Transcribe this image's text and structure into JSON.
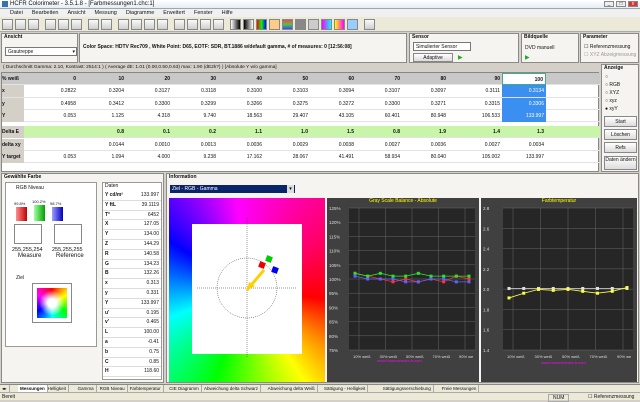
{
  "app": {
    "title": "HCFR Colorimeter - 3.5.1.8 - [Farbmessungen1.chc:1]"
  },
  "menu": [
    "Datei",
    "Bearbeiten",
    "Ansicht",
    "Messung",
    "Diagramme",
    "Erweitert",
    "Fenster",
    "Hilfe"
  ],
  "ansicht": {
    "title": "Ansicht",
    "value": "Grautreppe"
  },
  "colorspace": {
    "text": "Color Space: HDTV Rec709 , White Point: D65, EOTF: SDR, BT.1886 w/default gamma, # of measures: 0 [12:56:08]"
  },
  "sensor": {
    "title": "Sensor",
    "value": "Simulierter Sensor",
    "button": "Adaptive"
  },
  "source": {
    "title": "Bildquelle",
    "value": "DVD manuell"
  },
  "params": {
    "title": "Parameter",
    "check1": "Referenzmessung",
    "check2": "XYZ Abzeigmessung"
  },
  "summary": "( Durchschnitt Gamma: 2.10, Kontrast: 2514:1 ) ( Average dE: 1.01 (0.00,0.50,0.63) max: 1.90 (dE2k?) )  [Absolute Y w/o gamma]",
  "grid": {
    "header": [
      "% weiß",
      "0",
      "10",
      "20",
      "30",
      "40",
      "50",
      "60",
      "70",
      "80",
      "90",
      "100"
    ],
    "rows": [
      {
        "label": "x",
        "values": [
          "0.2822",
          "0.3204",
          "0.3127",
          "0.3118",
          "0.3100",
          "0.3103",
          "0.3094",
          "0.3107",
          "0.3097",
          "0.3111",
          "0.3134"
        ]
      },
      {
        "label": "y",
        "values": [
          "0.4958",
          "0.3412",
          "0.3300",
          "0.3299",
          "0.3266",
          "0.3275",
          "0.3272",
          "0.3300",
          "0.3271",
          "0.3315",
          "0.3306"
        ]
      },
      {
        "label": "Y",
        "values": [
          "0.053",
          "1.125",
          "4.318",
          "9.740",
          "18.563",
          "29.407",
          "43.105",
          "60.401",
          "80.948",
          "106.533",
          "133.997"
        ]
      },
      {
        "label": "Delta E",
        "values": [
          "",
          "0.8",
          "0.1",
          "0.2",
          "1.1",
          "1.0",
          "1.5",
          "0.8",
          "1.9",
          "1.4",
          "1.3"
        ]
      },
      {
        "label": "delta xy",
        "values": [
          "",
          "0.0144",
          "0.0010",
          "0.0013",
          "0.0036",
          "0.0029",
          "0.0038",
          "0.0027",
          "0.0036",
          "0.0027",
          "0.0034"
        ]
      },
      {
        "label": "Y target",
        "values": [
          "0.053",
          "1.094",
          "4.000",
          "9.238",
          "17.162",
          "28.067",
          "41.491",
          "58.934",
          "80.040",
          "105.002",
          "133.997"
        ]
      }
    ]
  },
  "sidebar": {
    "title": "Anzeige",
    "options": [
      "",
      "RGB",
      "XYZ",
      "xyz",
      "xyY"
    ],
    "buttons": [
      "Start",
      "Löschen",
      "Refs",
      "Daten ändern"
    ]
  },
  "selected": {
    "title": "Gewählte Farbe",
    "rgb_title": "RGB Niveau",
    "bars": [
      "99.8%",
      "100.2%",
      "98.7%"
    ],
    "bar_colors": [
      "#e02020",
      "#20c020",
      "#2040e0"
    ],
    "measure_value": "255,255,254",
    "measure_label": "Measure",
    "reference_value": "255,255,255",
    "reference_label": "Reference",
    "ziel": "Ziel"
  },
  "data": {
    "title": "Daten",
    "rows": [
      [
        "Y cd/m²",
        "133.997"
      ],
      [
        "Y ftL",
        "39.1119"
      ],
      [
        "T°",
        "6452"
      ],
      [
        "X",
        "127.05"
      ],
      [
        "Y",
        "134.00"
      ],
      [
        "Z",
        "144.29"
      ],
      [
        "R",
        "140.58"
      ],
      [
        "G",
        "134.23"
      ],
      [
        "B",
        "132.26"
      ],
      [
        "x",
        "0.313"
      ],
      [
        "y",
        "0.331"
      ],
      [
        "Y",
        "133.997"
      ],
      [
        "u'",
        "0.195"
      ],
      [
        "v'",
        "0.465"
      ],
      [
        "L",
        "100.00"
      ],
      [
        "a",
        "-0.41"
      ],
      [
        "b",
        "0.75"
      ],
      [
        "C",
        "0.85"
      ],
      [
        "H",
        "118.60"
      ]
    ]
  },
  "info": {
    "title": "Information",
    "dropdown": "Ziel - RGB - Gamma"
  },
  "chart1": {
    "title": "Gray Scale Balance - Absolute",
    "yticks": [
      "125%",
      "120%",
      "115%",
      "110%",
      "105%",
      "100%",
      "95%",
      "90%",
      "85%",
      "80%",
      "75%"
    ],
    "xticks": [
      "10% weiß",
      "30% weiß",
      "50% weiß",
      "70% weiß",
      "90% we"
    ],
    "series": [
      {
        "name": "R",
        "color": "#ff3030",
        "values": [
          102,
          101,
          100,
          99,
          100,
          99,
          100,
          99,
          101,
          100
        ]
      },
      {
        "name": "G",
        "color": "#30e030",
        "values": [
          102,
          101,
          102,
          101,
          101,
          102,
          101,
          101,
          101,
          101
        ]
      },
      {
        "name": "B",
        "color": "#6060ff",
        "values": [
          101,
          100,
          100,
          100,
          99,
          99,
          100,
          100,
          99,
          99
        ]
      }
    ],
    "ylim": [
      75,
      125
    ],
    "watermark": "www.homecinema-fr.com"
  },
  "chart2": {
    "title": "Farbtemperatur",
    "yticks": [
      "2.8",
      "2.6",
      "2.4",
      "2.2",
      "2.0",
      "1.8",
      "1.6",
      "1.4"
    ],
    "xticks": [
      "10% weiß",
      "30% weiß",
      "50% weiß",
      "70% weiß",
      "90% we"
    ],
    "series": [
      {
        "name": "Ziel",
        "color": "#e0e0e0",
        "values": [
          2.05,
          2.05,
          2.05,
          2.05,
          2.05,
          2.05,
          2.05,
          2.05,
          2.05
        ]
      },
      {
        "name": "Gemessen",
        "color": "#ffff40",
        "values": [
          1.95,
          2.0,
          2.04,
          2.03,
          2.04,
          2.02,
          2.0,
          2.02,
          2.06
        ]
      }
    ],
    "ylim": [
      1.4,
      2.9
    ],
    "watermark": "www.homecinema-fr.com"
  },
  "tabs": [
    "Messungen",
    "Helligkeit",
    "Gamma",
    "RGB Niveau",
    "Farbtemperatur",
    "CIE Diagramm",
    "Abweichung delta Schwarz",
    "Abweichung delta Weiß",
    "Sättigung - Helligkeit",
    "Sättigungsverschiebung",
    "Freie Messungen"
  ],
  "status": {
    "left": "Bereit",
    "num": "NUM",
    "checkbox": "Referenzmessung"
  }
}
